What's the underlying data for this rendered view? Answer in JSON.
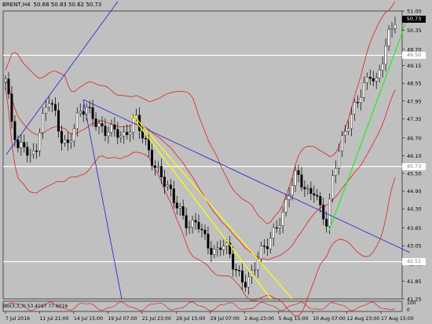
{
  "header": {
    "symbol_tf": "BRENT,H4",
    "ohlc": "50.68 50.83 50.62 50.73"
  },
  "indicator": {
    "label": "Sto(3,3,3) 53.4197 77.6016"
  },
  "colors": {
    "background": "#c0c0c0",
    "bollinger": "#e02020",
    "trend_blue": "#2020d0",
    "trend_yellow": "#ffff00",
    "trend_green": "#22ee22",
    "hline": "#ffffff",
    "tag_dark": "#000000",
    "tag_dark_text": "#ffffff"
  },
  "price_axis": {
    "min": 41.25,
    "max": 51.0,
    "ticks": [
      "51.00",
      "50.35",
      "49.70",
      "49.15",
      "48.55",
      "47.95",
      "47.35",
      "46.70",
      "46.10",
      "45.50",
      "44.90",
      "44.30",
      "43.65",
      "43.05",
      "42.45",
      "41.85",
      "41.25"
    ]
  },
  "price_tags": [
    {
      "label": "50.73",
      "value": 50.73,
      "dark": true
    },
    {
      "label": "49.50",
      "value": 49.5,
      "dark": false
    },
    {
      "label": "45.73",
      "value": 45.73,
      "dark": false
    },
    {
      "label": "42.51",
      "value": 42.51,
      "dark": false
    }
  ],
  "indicator_axis": {
    "ticks": [
      "100",
      "0"
    ]
  },
  "time_axis": {
    "labels": [
      "7 Jul 2016",
      "11 Jul 21:00",
      "14 Jul 15:00",
      "19 Jul 07:00",
      "21 Jul 23:00",
      "26 Jul 15:00",
      "29 Jul 07:00",
      "2 Aug 23:00",
      "5 Aug 15:00",
      "10 Aug 07:00",
      "12 Aug 23:00",
      "17 Aug 15:00"
    ]
  },
  "chart_data": {
    "type": "candlestick",
    "symbol": "BRENT",
    "timeframe": "H4",
    "hlines": [
      49.5,
      45.73,
      42.51
    ],
    "price_path": [
      [
        0,
        48.7
      ],
      [
        8,
        47.2
      ],
      [
        16,
        46.2
      ],
      [
        24,
        46.6
      ],
      [
        32,
        46.1
      ],
      [
        40,
        46.4
      ],
      [
        48,
        47.2
      ],
      [
        56,
        48.0
      ],
      [
        64,
        47.6
      ],
      [
        72,
        46.8
      ],
      [
        80,
        46.4
      ],
      [
        88,
        46.9
      ],
      [
        96,
        47.5
      ],
      [
        104,
        47.8
      ],
      [
        112,
        47.6
      ],
      [
        120,
        47.1
      ],
      [
        128,
        46.8
      ],
      [
        136,
        46.9
      ],
      [
        144,
        47.0
      ],
      [
        152,
        46.8
      ],
      [
        160,
        47.0
      ],
      [
        168,
        47.3
      ],
      [
        176,
        46.8
      ],
      [
        184,
        46.4
      ],
      [
        192,
        45.9
      ],
      [
        200,
        45.5
      ],
      [
        208,
        45.0
      ],
      [
        216,
        44.6
      ],
      [
        224,
        44.4
      ],
      [
        232,
        44.0
      ],
      [
        240,
        43.7
      ],
      [
        248,
        43.8
      ],
      [
        256,
        43.3
      ],
      [
        264,
        43.0
      ],
      [
        272,
        42.9
      ],
      [
        280,
        43.2
      ],
      [
        288,
        42.8
      ],
      [
        296,
        42.2
      ],
      [
        304,
        42.0
      ],
      [
        312,
        41.9
      ],
      [
        320,
        42.2
      ],
      [
        328,
        42.7
      ],
      [
        336,
        42.9
      ],
      [
        344,
        43.4
      ],
      [
        352,
        43.9
      ],
      [
        360,
        44.2
      ],
      [
        368,
        44.9
      ],
      [
        376,
        45.4
      ],
      [
        384,
        45.2
      ],
      [
        392,
        44.9
      ],
      [
        400,
        45.0
      ],
      [
        408,
        44.1
      ],
      [
        416,
        43.7
      ],
      [
        424,
        45.5
      ],
      [
        432,
        46.5
      ],
      [
        440,
        47.0
      ],
      [
        448,
        47.4
      ],
      [
        456,
        47.9
      ],
      [
        464,
        48.5
      ],
      [
        472,
        49.0
      ],
      [
        480,
        48.6
      ],
      [
        488,
        49.3
      ],
      [
        496,
        50.1
      ],
      [
        504,
        50.73
      ]
    ]
  }
}
